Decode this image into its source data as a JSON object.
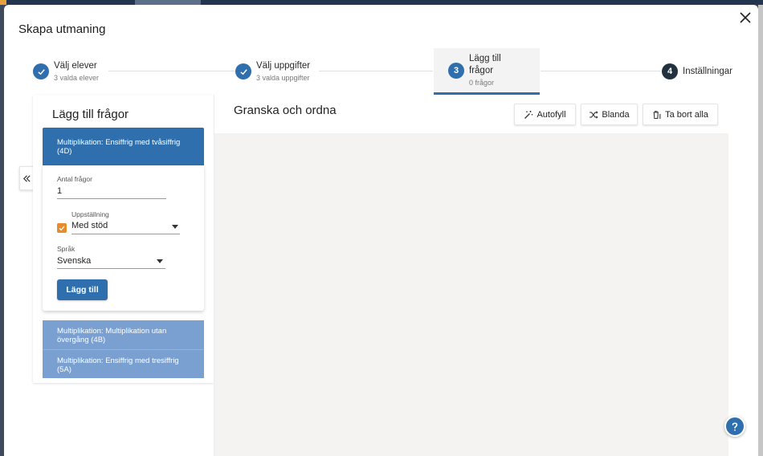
{
  "modal": {
    "title": "Skapa utmaning"
  },
  "stepper": {
    "steps": [
      {
        "label": "Välj elever",
        "sub": "3 valda elever",
        "state": "done"
      },
      {
        "label": "Välj uppgifter",
        "sub": "3 valda uppgifter",
        "state": "done"
      },
      {
        "number": "3",
        "label": "Lägg till frågor",
        "sub": "0 frågor",
        "state": "active"
      },
      {
        "number": "4",
        "label": "Inställningar",
        "sub": "",
        "state": "pending"
      }
    ]
  },
  "left": {
    "title": "Lägg till frågor",
    "active_card": {
      "title": "Multiplikation: Ensiffrig med tvåsiffrig (4D)",
      "count_label": "Antal frågor",
      "count_value": "1",
      "layout_label": "Uppställning",
      "layout_value": "Med stöd",
      "language_label": "Språk",
      "language_value": "Svenska",
      "add_label": "Lägg till"
    },
    "items": [
      {
        "title": "Multiplikation: Multiplikation utan övergång (4B)"
      },
      {
        "title": "Multiplikation: Ensiffrig med tresiffrig (5A)"
      }
    ]
  },
  "right": {
    "title": "Granska och ordna",
    "buttons": {
      "autofill": "Autofyll",
      "shuffle": "Blanda",
      "remove_all": "Ta bort alla"
    }
  },
  "colors": {
    "primary": "#2f6fae",
    "light": "#7aa0d1",
    "accent": "#e88b2a",
    "canvas": "#f4f3f1"
  }
}
